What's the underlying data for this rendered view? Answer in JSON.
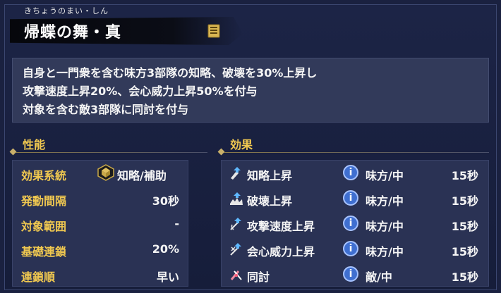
{
  "skill": {
    "furigana": "きちょうのまい・しん",
    "name": "帰蝶の舞・真",
    "description": [
      "自身と一門衆を含む味方3部隊の知略、破壊を30%上昇し",
      "攻撃速度上昇20%、会心威力上昇50%を付与",
      "対象を含む敵3部隊に同討を付与"
    ]
  },
  "performance": {
    "heading": "性能",
    "rows": [
      {
        "label": "効果系統",
        "value": "知略/補助",
        "icon": "strategy-support-icon"
      },
      {
        "label": "発動間隔",
        "value": "30秒"
      },
      {
        "label": "対象範囲",
        "value": "-"
      },
      {
        "label": "基礎連鎖",
        "value": "20%"
      },
      {
        "label": "連鎖順",
        "value": "早い"
      }
    ]
  },
  "effects": {
    "heading": "効果",
    "rows": [
      {
        "name": "知略上昇",
        "target": "味方/中",
        "duration": "15秒",
        "icon": "intellect-up-icon"
      },
      {
        "name": "破壊上昇",
        "target": "味方/中",
        "duration": "15秒",
        "icon": "destruction-up-icon"
      },
      {
        "name": "攻撃速度上昇",
        "target": "味方/中",
        "duration": "15秒",
        "icon": "attack-speed-up-icon"
      },
      {
        "name": "会心威力上昇",
        "target": "味方/中",
        "duration": "15秒",
        "icon": "critical-power-up-icon"
      },
      {
        "name": "同討",
        "target": "敵/中",
        "duration": "15秒",
        "icon": "friendly-fire-icon"
      }
    ],
    "info_symbol": "i"
  },
  "colors": {
    "background": "#1a2140",
    "panel": "#2a3254",
    "accent_gold": "#f0c850",
    "info_blue": "#3f6fd0"
  }
}
